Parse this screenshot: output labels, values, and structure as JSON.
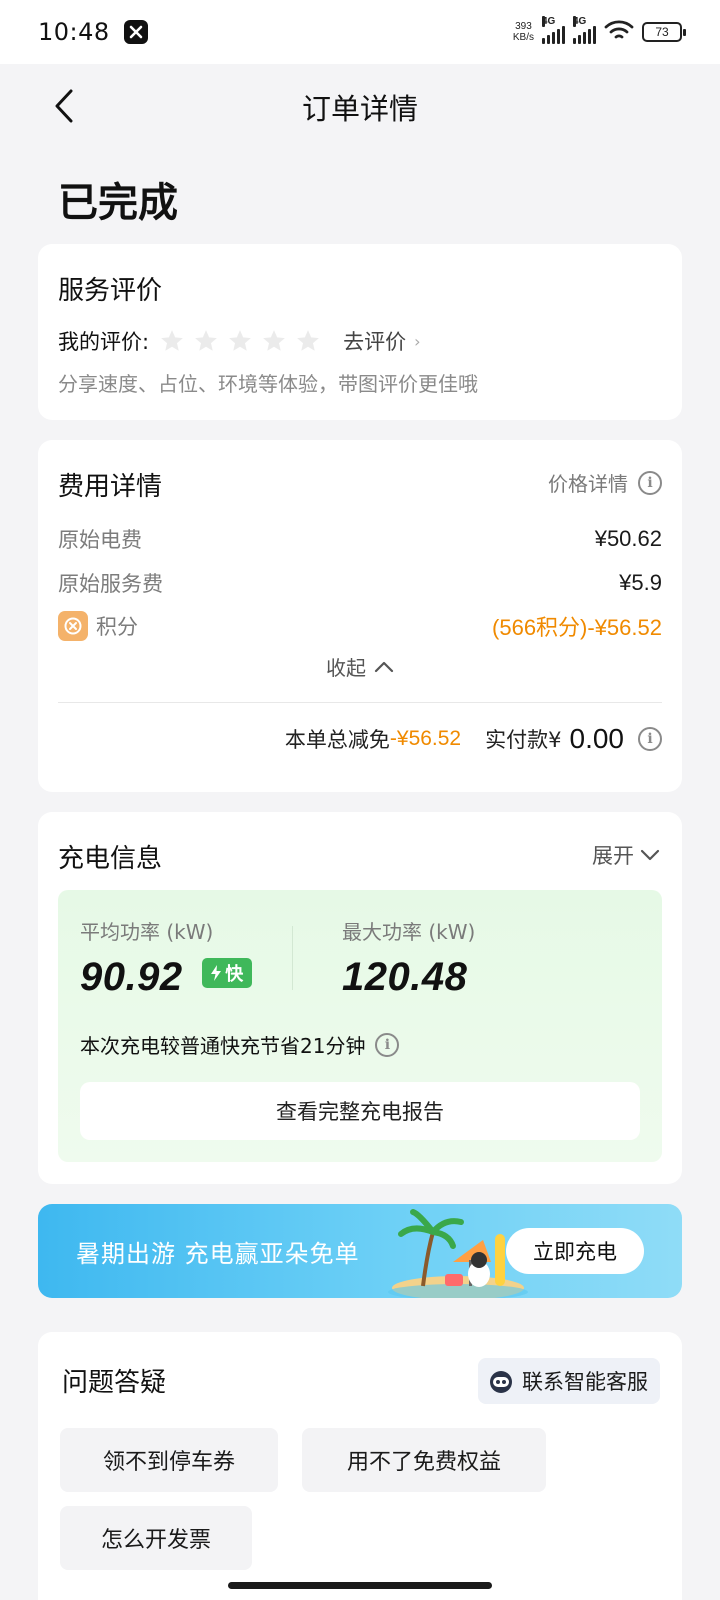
{
  "status_bar": {
    "time": "10:48",
    "net_speed_value": "393",
    "net_speed_unit": "KB/s",
    "signal_1": "4G",
    "signal_2": "4G",
    "battery": "73"
  },
  "nav": {
    "title": "订单详情",
    "back_icon": "chevron-left-icon"
  },
  "order_status": "已完成",
  "evaluation": {
    "title": "服务评价",
    "my_rating_label": "我的评价:",
    "stars_total": 5,
    "stars_filled": 0,
    "go_rate": "去评价",
    "hint": "分享速度、占位、环境等体验，带图评价更佳哦"
  },
  "fee": {
    "title": "费用详情",
    "price_detail": "价格详情",
    "rows": [
      {
        "label": "原始电费",
        "value": "¥50.62"
      },
      {
        "label": "原始服务费",
        "value": "¥5.9"
      },
      {
        "label": "积分",
        "value": "(566积分)-¥56.52"
      }
    ],
    "collapse": "收起",
    "total_discount_label": "本单总减免",
    "total_discount_value": "-¥56.52",
    "actual_label": "实付款¥",
    "actual_amount": "0.00"
  },
  "charging": {
    "title": "充电信息",
    "expand": "展开",
    "avg_power_label": "平均功率 (kW)",
    "avg_power_value": "90.92",
    "fast_badge": "快",
    "max_power_label": "最大功率 (kW)",
    "max_power_value": "120.48",
    "save_hint": "本次充电较普通快充节省21分钟",
    "report_button": "查看完整充电报告"
  },
  "promo": {
    "text": "暑期出游 充电赢亚朵免单",
    "button": "立即充电"
  },
  "faq": {
    "title": "问题答疑",
    "service_button": "联系智能客服",
    "questions": [
      "领不到停车券",
      "用不了免费权益",
      "怎么开发票"
    ]
  },
  "colors": {
    "accent_orange": "#f08a00",
    "fast_green": "#3fb85a",
    "promo_blue": "#3eb8f0"
  }
}
